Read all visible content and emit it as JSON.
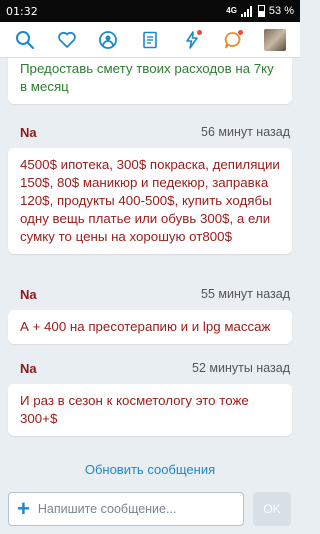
{
  "status": {
    "time": "01:32",
    "network": "4G",
    "battery": "53 %"
  },
  "toolbar": {
    "icons": [
      "search-icon",
      "heart-icon",
      "broadcast-icon",
      "document-icon",
      "lightning-icon",
      "chat-bubble-icon",
      "avatar"
    ]
  },
  "messages": [
    {
      "author": "",
      "time_ago": "",
      "text": "Предоставь смету твоих расходов на 7ку в месяц"
    },
    {
      "author": "Na",
      "time_ago": "56 минут назад",
      "text": "4500$ ипотека, 300$ покраска, депиляции 150$, 80$ маникюр и педекюр, заправка 120$, продукты 400-500$, купить ходябы одну вещь платье или обувь 300$, а е​ли сумку то цены на хорошую от800$"
    },
    {
      "author": "Na",
      "time_ago": "55 минут назад",
      "text": "А + 400 на пресотерапию и и lpg массаж"
    },
    {
      "author": "Na",
      "time_ago": "52 минуты назад",
      "text": "И раз в сезон к косметологу это тоже 300+$"
    }
  ],
  "refresh_label": "Обновить сообщения",
  "composer": {
    "placeholder": "Напишите сообщение...",
    "send_label": "OK"
  },
  "colors": {
    "accent": "#1e88c8",
    "author": "#8b1a1a",
    "quoted_text": "#2e7d32"
  }
}
